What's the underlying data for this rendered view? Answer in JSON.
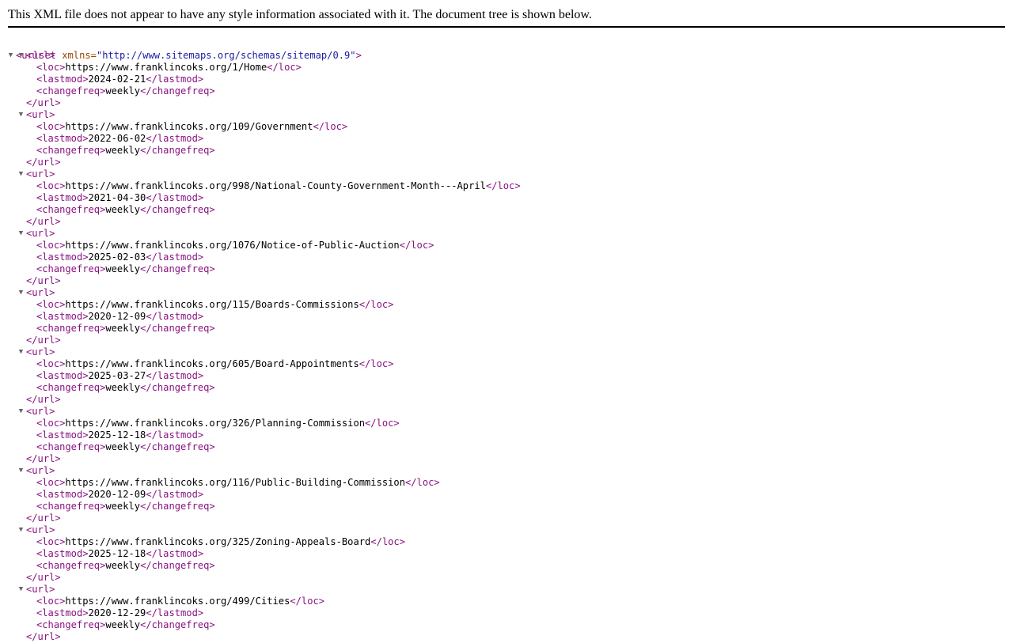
{
  "header": {
    "message": "This XML file does not appear to have any style information associated with it. The document tree is shown below."
  },
  "root": {
    "open_tag_prefix": "<urlset",
    "attr_name": "xmlns=",
    "attr_value": "\"http://www.sitemaps.org/schemas/sitemap/0.9\"",
    "open_tag_suffix": ">",
    "toggle_glyph": "▼"
  },
  "tags": {
    "url_open": "<url>",
    "url_close": "</url>",
    "loc_open": "<loc>",
    "loc_close": "</loc>",
    "lastmod_open": "<lastmod>",
    "lastmod_close": "</lastmod>",
    "changefreq_open": "<changefreq>",
    "changefreq_close": "</changefreq>"
  },
  "urls": [
    {
      "loc": "https://www.franklincoks.org/1/Home",
      "lastmod": "2024-02-21",
      "changefreq": "weekly"
    },
    {
      "loc": "https://www.franklincoks.org/109/Government",
      "lastmod": "2022-06-02",
      "changefreq": "weekly"
    },
    {
      "loc": "https://www.franklincoks.org/998/National-County-Government-Month---April",
      "lastmod": "2021-04-30",
      "changefreq": "weekly"
    },
    {
      "loc": "https://www.franklincoks.org/1076/Notice-of-Public-Auction",
      "lastmod": "2025-02-03",
      "changefreq": "weekly"
    },
    {
      "loc": "https://www.franklincoks.org/115/Boards-Commissions",
      "lastmod": "2020-12-09",
      "changefreq": "weekly"
    },
    {
      "loc": "https://www.franklincoks.org/605/Board-Appointments",
      "lastmod": "2025-03-27",
      "changefreq": "weekly"
    },
    {
      "loc": "https://www.franklincoks.org/326/Planning-Commission",
      "lastmod": "2025-12-18",
      "changefreq": "weekly"
    },
    {
      "loc": "https://www.franklincoks.org/116/Public-Building-Commission",
      "lastmod": "2020-12-09",
      "changefreq": "weekly"
    },
    {
      "loc": "https://www.franklincoks.org/325/Zoning-Appeals-Board",
      "lastmod": "2025-12-18",
      "changefreq": "weekly"
    },
    {
      "loc": "https://www.franklincoks.org/499/Cities",
      "lastmod": "2020-12-29",
      "changefreq": "weekly"
    }
  ]
}
